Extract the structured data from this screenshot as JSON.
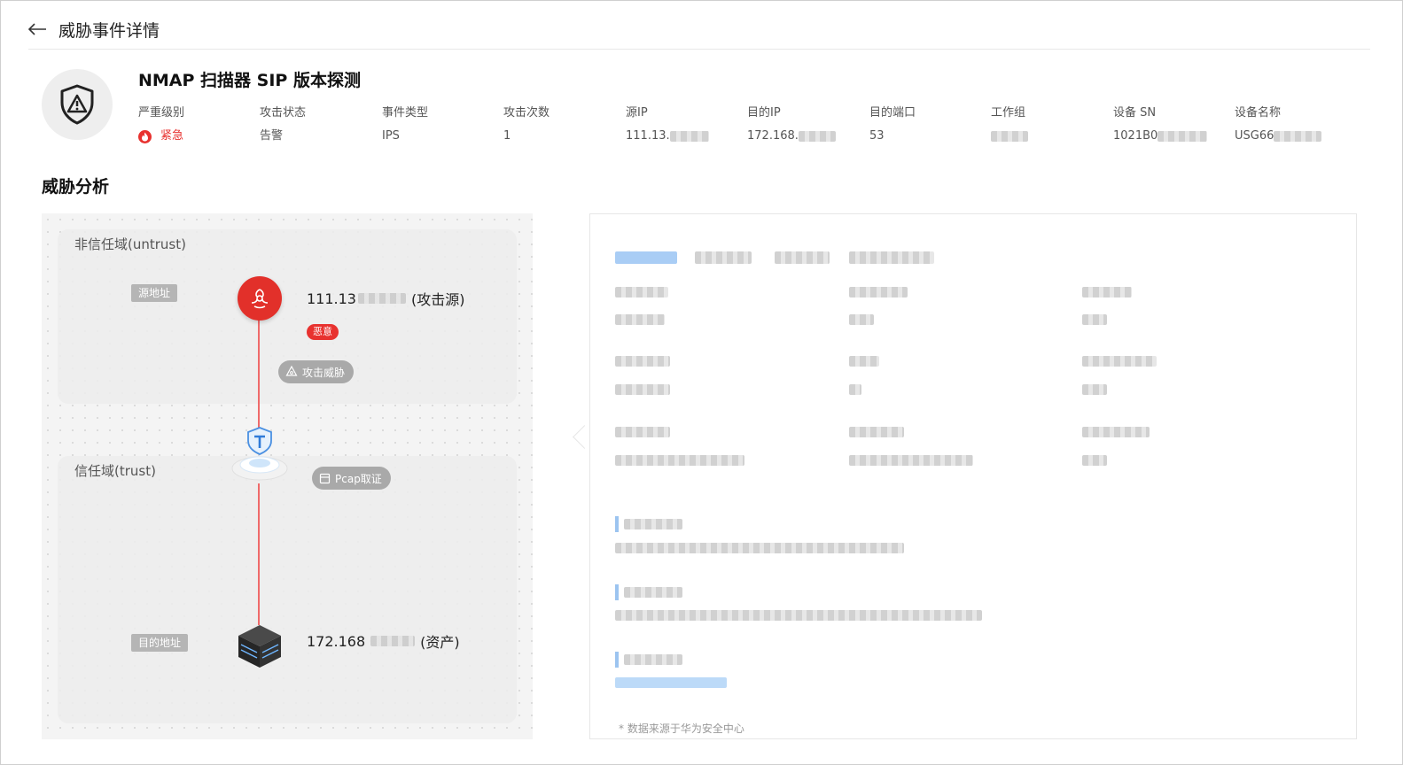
{
  "header": {
    "title": "威胁事件详情"
  },
  "event": {
    "title": "NMAP 扫描器 SIP 版本探测",
    "fields": [
      {
        "label": "严重级别",
        "value": "紧急",
        "color": "#e8322f"
      },
      {
        "label": "攻击状态",
        "value": "告警"
      },
      {
        "label": "事件类型",
        "value": "IPS"
      },
      {
        "label": "攻击次数",
        "value": "1"
      },
      {
        "label": "源IP",
        "value": "111.13."
      },
      {
        "label": "目的IP",
        "value": "172.168."
      },
      {
        "label": "目的端口",
        "value": "53"
      },
      {
        "label": "工作组",
        "value": ""
      },
      {
        "label": "设备 SN",
        "value": "1021B0"
      },
      {
        "label": "设备名称",
        "value": "USG66"
      }
    ]
  },
  "analysis": {
    "title": "威胁分析",
    "untrust_zone": "非信任域(untrust)",
    "trust_zone": "信任域(trust)",
    "source_tag": "源地址",
    "dest_tag": "目的地址",
    "attacker_ip": "111.13",
    "attacker_suffix": "(攻击源)",
    "malicious_badge": "恶意",
    "attack_pill": "攻击威胁",
    "pcap_pill": "Pcap取证",
    "asset_ip": "172.168",
    "asset_suffix": "(资产)",
    "footnote": "* 数据来源于华为安全中心"
  },
  "colors": {
    "critical": "#e8322f",
    "edge": "#ef6a6a",
    "tab_active": "#a9cdf5"
  }
}
